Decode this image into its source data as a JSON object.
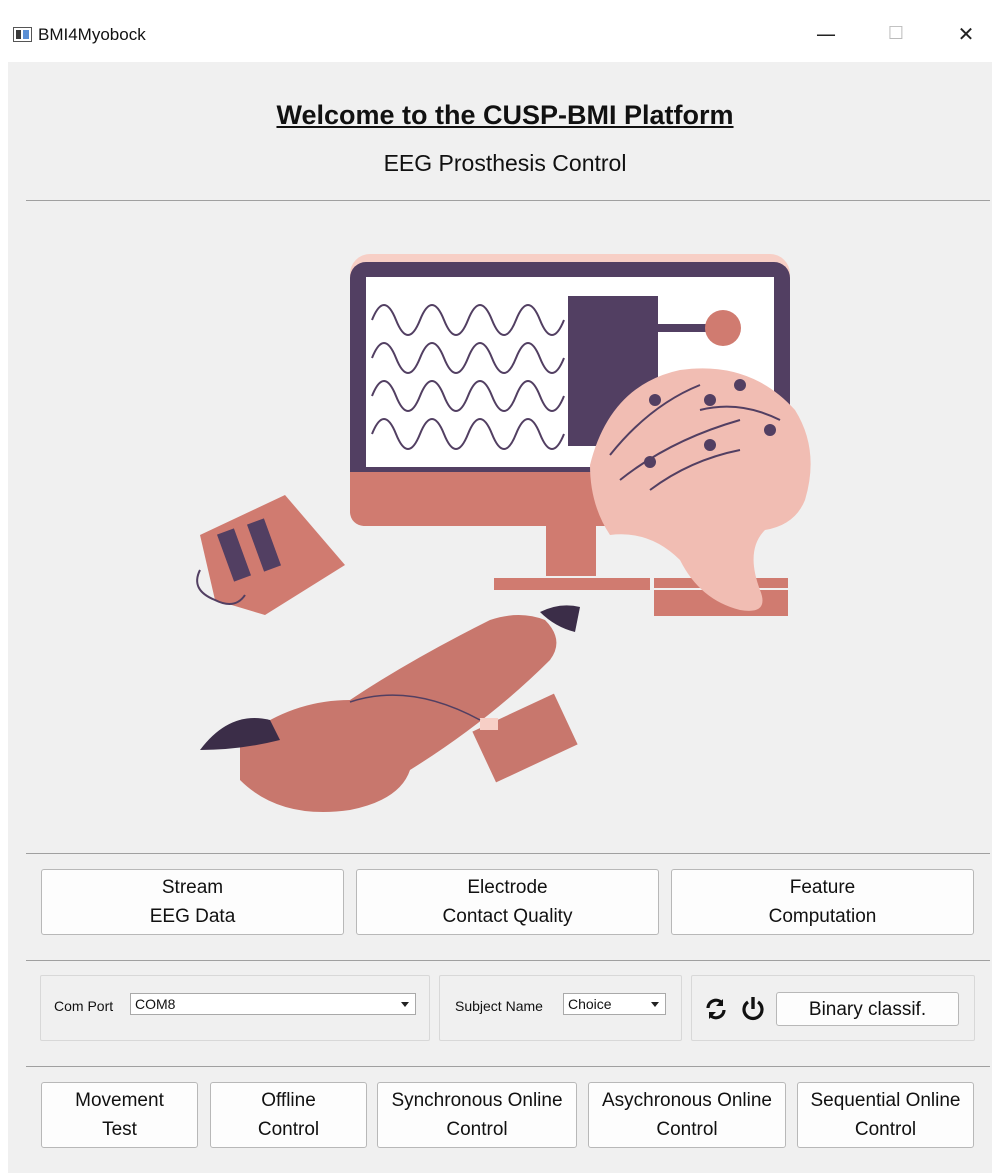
{
  "window": {
    "title": "BMI4Myobock",
    "minimize_glyph": "—",
    "maximize_glyph": "☐",
    "close_glyph": "✕"
  },
  "header": {
    "welcome": "Welcome to the CUSP-BMI Platform",
    "subtitle": "EEG Prosthesis Control"
  },
  "illustration": {
    "name": "bmi-illustration",
    "colors": {
      "dark": "#523f62",
      "salmon": "#d07b70",
      "pink": "#f7cfc6",
      "light": "#ffffff"
    }
  },
  "top_buttons": [
    {
      "line1": "Stream",
      "line2": "EEG Data"
    },
    {
      "line1": "Electrode",
      "line2": "Contact Quality"
    },
    {
      "line1": "Feature",
      "line2": "Computation"
    }
  ],
  "settings": {
    "com_port_label": "Com Port",
    "com_port_value": "COM8",
    "subject_label": "Subject Name",
    "subject_value": "Choice",
    "refresh_icon": "refresh-icon",
    "power_icon": "power-icon",
    "binary_label": "Binary classif."
  },
  "bottom_buttons": [
    {
      "line1": "Movement",
      "line2": "Test"
    },
    {
      "line1": "Offline",
      "line2": "Control"
    },
    {
      "line1": "Synchronous Online",
      "line2": "Control"
    },
    {
      "line1": "Asychronous Online",
      "line2": "Control"
    },
    {
      "line1": "Sequential Online",
      "line2": "Control"
    }
  ]
}
